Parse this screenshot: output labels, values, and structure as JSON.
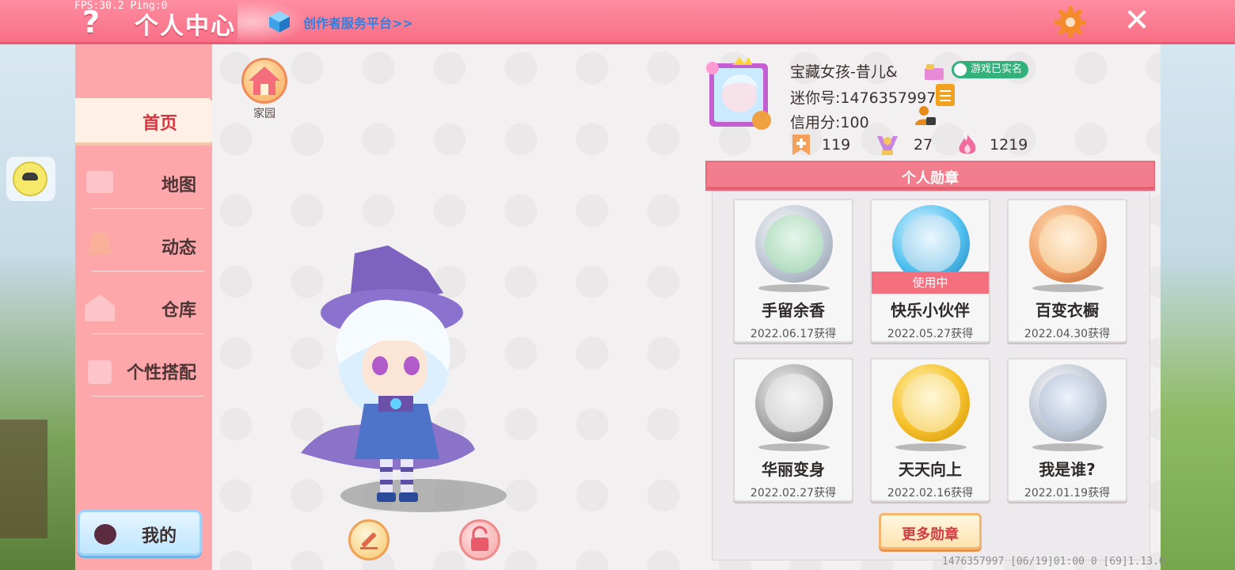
{
  "overlay": {
    "fps": "FPS:30.2  Ping:0"
  },
  "header": {
    "help_glyph": "?",
    "title": "个人中心",
    "creator_link": "创作者服务平台>>"
  },
  "sidebar": {
    "items": [
      {
        "label": "首页",
        "active": true
      },
      {
        "label": "地图",
        "active": false
      },
      {
        "label": "动态",
        "active": false
      },
      {
        "label": "仓库",
        "active": false
      },
      {
        "label": "个性搭配",
        "active": false
      }
    ],
    "mine_label": "我的"
  },
  "home": {
    "label": "家园"
  },
  "profile": {
    "name": "宝藏女孩-昔儿&",
    "verified": "游戏已实名",
    "mini_id": "迷你号:1476357997",
    "credit": "信用分:100",
    "stats": [
      {
        "icon": "bookmark-plus-icon",
        "value": "119"
      },
      {
        "icon": "trophy-person-icon",
        "value": "27"
      },
      {
        "icon": "flame-icon",
        "value": "1219"
      }
    ]
  },
  "badges": {
    "title": "个人勋章",
    "in_use_label": "使用中",
    "items": [
      {
        "name": "手留余香",
        "date": "2022.06.17获得",
        "medal": "silver",
        "in_use": false
      },
      {
        "name": "快乐小伙伴",
        "date": "2022.05.27获得",
        "medal": "blue",
        "in_use": true
      },
      {
        "name": "百变衣橱",
        "date": "2022.04.30获得",
        "medal": "bronze",
        "in_use": false
      },
      {
        "name": "华丽变身",
        "date": "2022.02.27获得",
        "medal": "gray",
        "in_use": false
      },
      {
        "name": "天天向上",
        "date": "2022.02.16获得",
        "medal": "gold",
        "in_use": false
      },
      {
        "name": "我是谁?",
        "date": "2022.01.19获得",
        "medal": "silver",
        "in_use": false
      }
    ],
    "more_label": "更多勋章"
  },
  "footer": {
    "text": "1476357997    [06/19]01:00 0  [69]1.13.0"
  },
  "colors": {
    "topbar": "#f86f86",
    "sidebar": "#fda7aa",
    "accent_red": "#d8343f",
    "verified_green": "#33b07b"
  }
}
